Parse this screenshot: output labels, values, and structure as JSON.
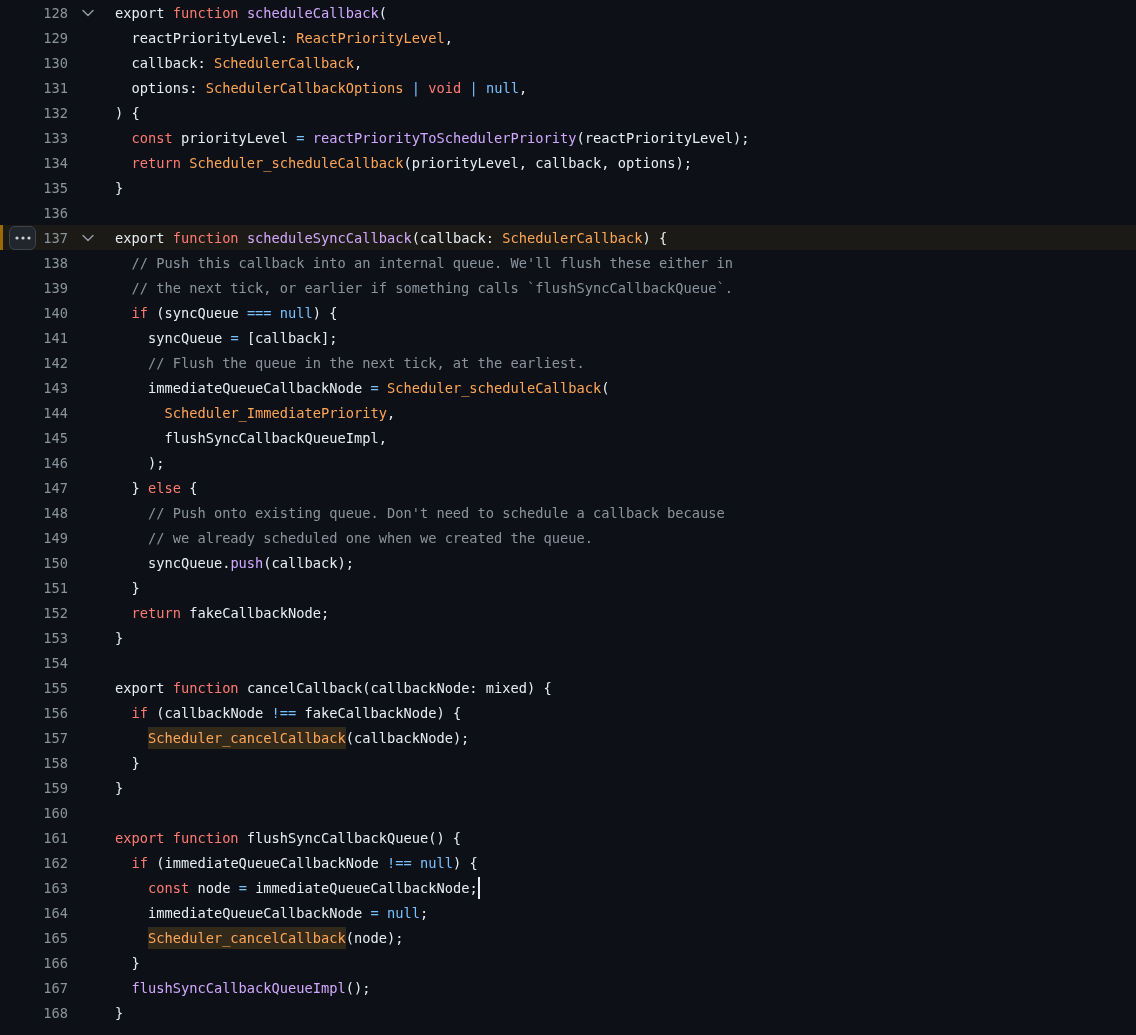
{
  "lines": [
    {
      "number": "128",
      "foldable": true,
      "selected": false,
      "cursor": false,
      "tokens": [
        {
          "kind": "text",
          "text": "export "
        },
        {
          "kind": "keyword",
          "text": "function"
        },
        {
          "kind": "entity",
          "text": " scheduleCallback"
        },
        {
          "kind": "text",
          "text": "("
        }
      ]
    },
    {
      "number": "129",
      "foldable": false,
      "selected": false,
      "cursor": false,
      "tokens": [
        {
          "kind": "text",
          "text": "  reactPriorityLevel: "
        },
        {
          "kind": "type",
          "text": "ReactPriorityLevel"
        },
        {
          "kind": "text",
          "text": ","
        }
      ]
    },
    {
      "number": "130",
      "foldable": false,
      "selected": false,
      "cursor": false,
      "tokens": [
        {
          "kind": "text",
          "text": "  callback: "
        },
        {
          "kind": "type",
          "text": "SchedulerCallback"
        },
        {
          "kind": "text",
          "text": ","
        }
      ]
    },
    {
      "number": "131",
      "foldable": false,
      "selected": false,
      "cursor": false,
      "tokens": [
        {
          "kind": "text",
          "text": "  options: "
        },
        {
          "kind": "type",
          "text": "SchedulerCallbackOptions"
        },
        {
          "kind": "operator",
          "text": " |"
        },
        {
          "kind": "keyword",
          "text": " void"
        },
        {
          "kind": "operator",
          "text": " |"
        },
        {
          "kind": "constant",
          "text": " null"
        },
        {
          "kind": "text",
          "text": ","
        }
      ]
    },
    {
      "number": "132",
      "foldable": false,
      "selected": false,
      "cursor": false,
      "tokens": [
        {
          "kind": "text",
          "text": ") {"
        }
      ]
    },
    {
      "number": "133",
      "foldable": false,
      "selected": false,
      "cursor": false,
      "tokens": [
        {
          "kind": "keyword",
          "text": "  const"
        },
        {
          "kind": "text",
          "text": " priorityLevel "
        },
        {
          "kind": "operator",
          "text": "="
        },
        {
          "kind": "entity",
          "text": " reactPriorityToSchedulerPriority"
        },
        {
          "kind": "text",
          "text": "(reactPriorityLevel);"
        }
      ]
    },
    {
      "number": "134",
      "foldable": false,
      "selected": false,
      "cursor": false,
      "tokens": [
        {
          "kind": "keyword",
          "text": "  return"
        },
        {
          "kind": "type",
          "text": " Scheduler_scheduleCallback"
        },
        {
          "kind": "text",
          "text": "(priorityLevel, callback, options);"
        }
      ]
    },
    {
      "number": "135",
      "foldable": false,
      "selected": false,
      "cursor": false,
      "tokens": [
        {
          "kind": "text",
          "text": "}"
        }
      ]
    },
    {
      "number": "136",
      "foldable": false,
      "selected": false,
      "cursor": false
    },
    {
      "number": "137",
      "foldable": true,
      "selected": true,
      "cursor": false,
      "tokens": [
        {
          "kind": "text",
          "text": "export "
        },
        {
          "kind": "keyword",
          "text": "function"
        },
        {
          "kind": "entity",
          "text": " scheduleSyncCallback"
        },
        {
          "kind": "text",
          "text": "(callback: "
        },
        {
          "kind": "type",
          "text": "SchedulerCallback"
        },
        {
          "kind": "text",
          "text": ") {"
        }
      ]
    },
    {
      "number": "138",
      "foldable": false,
      "selected": false,
      "cursor": false,
      "tokens": [
        {
          "kind": "comment",
          "text": "  // Push this callback into an internal queue. We'll flush these either in"
        }
      ]
    },
    {
      "number": "139",
      "foldable": false,
      "selected": false,
      "cursor": false,
      "tokens": [
        {
          "kind": "comment",
          "text": "  // the next tick, or earlier if something calls `flushSyncCallbackQueue`."
        }
      ]
    },
    {
      "number": "140",
      "foldable": false,
      "selected": false,
      "cursor": false,
      "tokens": [
        {
          "kind": "keyword",
          "text": "  if"
        },
        {
          "kind": "text",
          "text": " (syncQueue "
        },
        {
          "kind": "operator",
          "text": "==="
        },
        {
          "kind": "constant",
          "text": " null"
        },
        {
          "kind": "text",
          "text": ") {"
        }
      ]
    },
    {
      "number": "141",
      "foldable": false,
      "selected": false,
      "cursor": false,
      "tokens": [
        {
          "kind": "text",
          "text": "    syncQueue "
        },
        {
          "kind": "operator",
          "text": "="
        },
        {
          "kind": "text",
          "text": " [callback];"
        }
      ]
    },
    {
      "number": "142",
      "foldable": false,
      "selected": false,
      "cursor": false,
      "tokens": [
        {
          "kind": "comment",
          "text": "    // Flush the queue in the next tick, at the earliest."
        }
      ]
    },
    {
      "number": "143",
      "foldable": false,
      "selected": false,
      "cursor": false,
      "tokens": [
        {
          "kind": "text",
          "text": "    immediateQueueCallbackNode "
        },
        {
          "kind": "operator",
          "text": "="
        },
        {
          "kind": "type",
          "text": " Scheduler_scheduleCallback"
        },
        {
          "kind": "text",
          "text": "("
        }
      ]
    },
    {
      "number": "144",
      "foldable": false,
      "selected": false,
      "cursor": false,
      "tokens": [
        {
          "kind": "type",
          "text": "      Scheduler_ImmediatePriority"
        },
        {
          "kind": "text",
          "text": ","
        }
      ]
    },
    {
      "number": "145",
      "foldable": false,
      "selected": false,
      "cursor": false,
      "tokens": [
        {
          "kind": "text",
          "text": "      flushSyncCallbackQueueImpl,"
        }
      ]
    },
    {
      "number": "146",
      "foldable": false,
      "selected": false,
      "cursor": false,
      "tokens": [
        {
          "kind": "text",
          "text": "    );"
        }
      ]
    },
    {
      "number": "147",
      "foldable": false,
      "selected": false,
      "cursor": false,
      "tokens": [
        {
          "kind": "text",
          "text": "  } "
        },
        {
          "kind": "keyword",
          "text": "else"
        },
        {
          "kind": "text",
          "text": " {"
        }
      ]
    },
    {
      "number": "148",
      "foldable": false,
      "selected": false,
      "cursor": false,
      "tokens": [
        {
          "kind": "comment",
          "text": "    // Push onto existing queue. Don't need to schedule a callback because"
        }
      ]
    },
    {
      "number": "149",
      "foldable": false,
      "selected": false,
      "cursor": false,
      "tokens": [
        {
          "kind": "comment",
          "text": "    // we already scheduled one when we created the queue."
        }
      ]
    },
    {
      "number": "150",
      "foldable": false,
      "selected": false,
      "cursor": false,
      "tokens": [
        {
          "kind": "text",
          "text": "    syncQueue."
        },
        {
          "kind": "entity",
          "text": "push"
        },
        {
          "kind": "text",
          "text": "(callback);"
        }
      ]
    },
    {
      "number": "151",
      "foldable": false,
      "selected": false,
      "cursor": false,
      "tokens": [
        {
          "kind": "text",
          "text": "  }"
        }
      ]
    },
    {
      "number": "152",
      "foldable": false,
      "selected": false,
      "cursor": false,
      "tokens": [
        {
          "kind": "keyword",
          "text": "  return"
        },
        {
          "kind": "text",
          "text": " fakeCallbackNode;"
        }
      ]
    },
    {
      "number": "153",
      "foldable": false,
      "selected": false,
      "cursor": false,
      "tokens": [
        {
          "kind": "text",
          "text": "}"
        }
      ]
    },
    {
      "number": "154",
      "foldable": false,
      "selected": false,
      "cursor": false
    },
    {
      "number": "155",
      "foldable": false,
      "selected": false,
      "cursor": false,
      "tokens": [
        {
          "kind": "text",
          "text": "export "
        },
        {
          "kind": "keyword",
          "text": "function"
        },
        {
          "kind": "text",
          "text": " cancelCallback(callbackNode: mixed) {"
        }
      ]
    },
    {
      "number": "156",
      "foldable": false,
      "selected": false,
      "cursor": false,
      "tokens": [
        {
          "kind": "keyword",
          "text": "  if"
        },
        {
          "kind": "text",
          "text": " (callbackNode "
        },
        {
          "kind": "operator",
          "text": "!=="
        },
        {
          "kind": "text",
          "text": " fakeCallbackNode) {"
        }
      ]
    },
    {
      "number": "157",
      "foldable": false,
      "selected": false,
      "cursor": false,
      "tokens": [
        {
          "kind": "match",
          "text": "    Scheduler_cancelCallback"
        },
        {
          "kind": "text",
          "text": "(callbackNode);"
        }
      ]
    },
    {
      "number": "158",
      "foldable": false,
      "selected": false,
      "cursor": false,
      "tokens": [
        {
          "kind": "text",
          "text": "  }"
        }
      ]
    },
    {
      "number": "159",
      "foldable": false,
      "selected": false,
      "cursor": false,
      "tokens": [
        {
          "kind": "text",
          "text": "}"
        }
      ]
    },
    {
      "number": "160",
      "foldable": false,
      "selected": false,
      "cursor": false
    },
    {
      "number": "161",
      "foldable": false,
      "selected": false,
      "cursor": false,
      "tokens": [
        {
          "kind": "keyword",
          "text": "export function"
        },
        {
          "kind": "text",
          "text": " flushSyncCallbackQueue() {"
        }
      ]
    },
    {
      "number": "162",
      "foldable": false,
      "selected": false,
      "cursor": false,
      "tokens": [
        {
          "kind": "keyword",
          "text": "  if"
        },
        {
          "kind": "text",
          "text": " (immediateQueueCallbackNode "
        },
        {
          "kind": "operator",
          "text": "!=="
        },
        {
          "kind": "constant",
          "text": " null"
        },
        {
          "kind": "text",
          "text": ") {"
        }
      ]
    },
    {
      "number": "163",
      "foldable": false,
      "selected": false,
      "cursor": true,
      "tokens": [
        {
          "kind": "keyword",
          "text": "    const"
        },
        {
          "kind": "text",
          "text": " node "
        },
        {
          "kind": "operator",
          "text": "="
        },
        {
          "kind": "text",
          "text": " immediateQueueCallbackNode;"
        }
      ]
    },
    {
      "number": "164",
      "foldable": false,
      "selected": false,
      "cursor": false,
      "tokens": [
        {
          "kind": "text",
          "text": "    immediateQueueCallbackNode "
        },
        {
          "kind": "operator",
          "text": "="
        },
        {
          "kind": "constant",
          "text": " null"
        },
        {
          "kind": "text",
          "text": ";"
        }
      ]
    },
    {
      "number": "165",
      "foldable": false,
      "selected": false,
      "cursor": false,
      "tokens": [
        {
          "kind": "match",
          "text": "    Scheduler_cancelCallback"
        },
        {
          "kind": "text",
          "text": "(node);"
        }
      ]
    },
    {
      "number": "166",
      "foldable": false,
      "selected": false,
      "cursor": false,
      "tokens": [
        {
          "kind": "text",
          "text": "  }"
        }
      ]
    },
    {
      "number": "167",
      "foldable": false,
      "selected": false,
      "cursor": false,
      "tokens": [
        {
          "kind": "entity",
          "text": "  flushSyncCallbackQueueImpl"
        },
        {
          "kind": "text",
          "text": "();"
        }
      ]
    },
    {
      "number": "168",
      "foldable": false,
      "selected": false,
      "cursor": false,
      "tokens": [
        {
          "kind": "text",
          "text": "}"
        }
      ]
    }
  ]
}
